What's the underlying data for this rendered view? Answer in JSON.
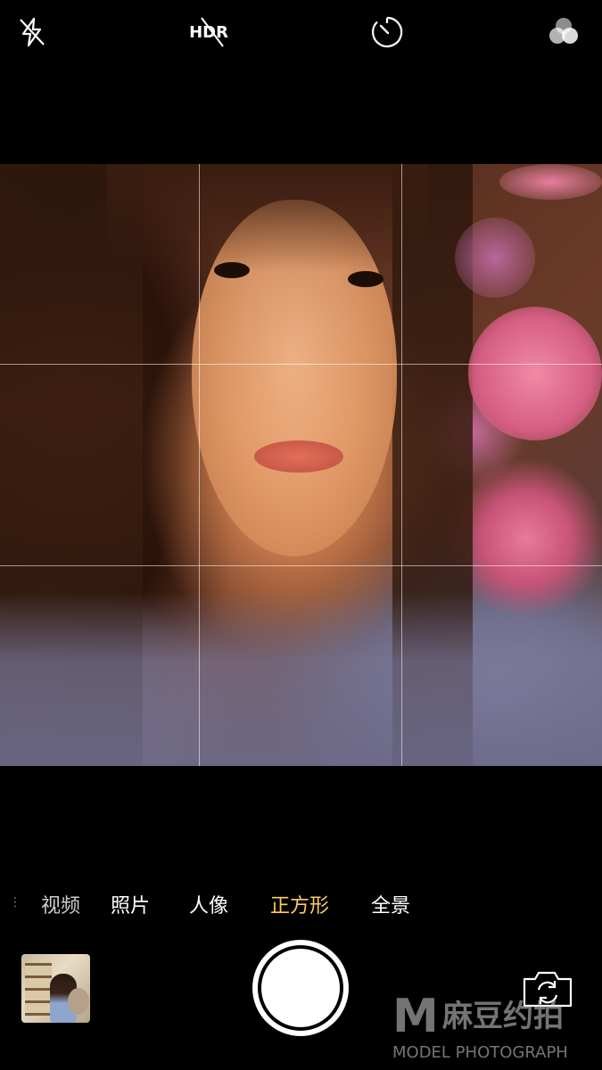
{
  "top_bar": {
    "flash": {
      "icon": "flash-off-icon"
    },
    "hdr": {
      "label": "HDR",
      "icon": "hdr-off-icon"
    },
    "timer": {
      "icon": "timer-icon"
    },
    "filters": {
      "icon": "filters-icon"
    }
  },
  "viewfinder": {
    "grid": "on",
    "subject": "selfie-portrait"
  },
  "modes": {
    "items": [
      "视频",
      "照片",
      "人像",
      "正方形",
      "全景"
    ],
    "active": "正方形",
    "active_color": "#ffcc66"
  },
  "bottom_bar": {
    "thumbnail": {
      "icon": "last-photo-thumbnail"
    },
    "shutter": {
      "icon": "shutter-button"
    },
    "switch_camera": {
      "icon": "switch-camera-icon"
    }
  },
  "watermark": {
    "logo": "M",
    "name_cn": "麻豆约拍",
    "name_en": "MODEL PHOTOGRAPH"
  }
}
